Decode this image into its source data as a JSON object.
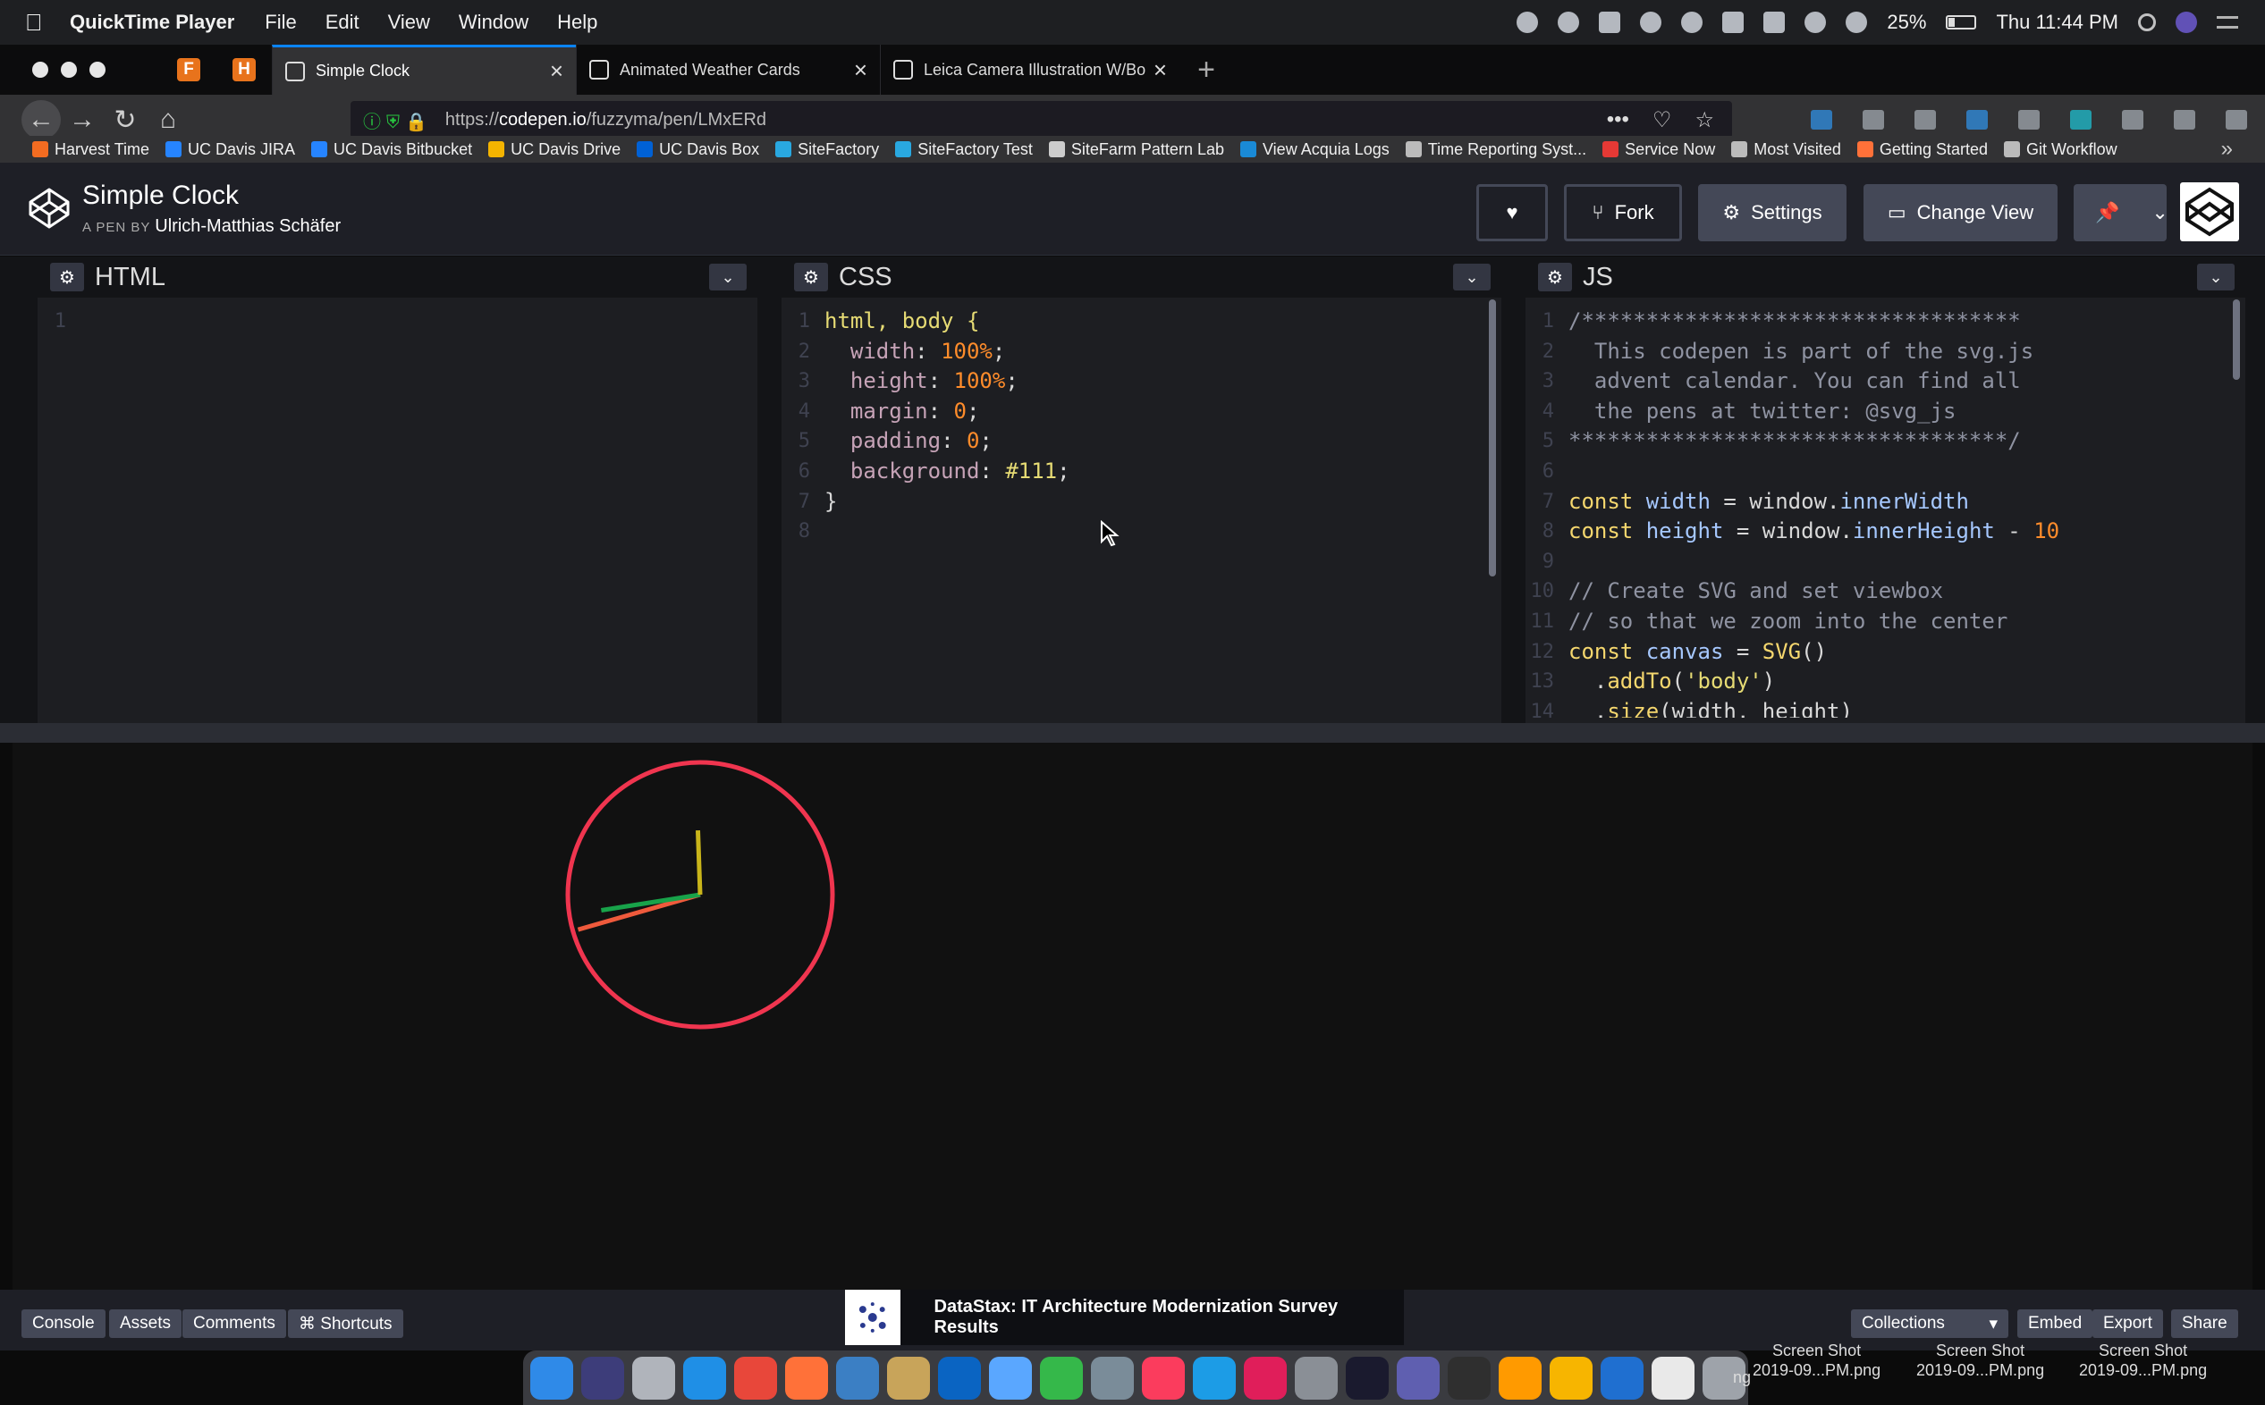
{
  "menubar": {
    "app_name": "QuickTime Player",
    "menus": [
      "File",
      "Edit",
      "View",
      "Window",
      "Help"
    ],
    "battery": "25%",
    "clock": "Thu 11:44 PM"
  },
  "tabs": [
    {
      "label": "Simple Clock",
      "active": true
    },
    {
      "label": "Animated Weather Cards",
      "active": false
    },
    {
      "label": "Leica Camera Illustration W/Bo",
      "active": false
    }
  ],
  "pinned_tabs": [
    "F",
    "H"
  ],
  "address": {
    "prefix": "https://",
    "host": "codepen.io",
    "path": "/fuzzyma/pen/LMxERd"
  },
  "bookmarks": [
    {
      "label": "Harvest Time",
      "color": "#f36c21"
    },
    {
      "label": "UC Davis JIRA",
      "color": "#2684ff"
    },
    {
      "label": "UC Davis Bitbucket",
      "color": "#2684ff"
    },
    {
      "label": "UC Davis Drive",
      "color": "#f4b400"
    },
    {
      "label": "UC Davis  Box",
      "color": "#0061d5"
    },
    {
      "label": "SiteFactory",
      "color": "#29a8e0"
    },
    {
      "label": "SiteFactory Test",
      "color": "#29a8e0"
    },
    {
      "label": "SiteFarm Pattern Lab",
      "color": "#cccccc"
    },
    {
      "label": "View Acquia Logs",
      "color": "#1a8ad6"
    },
    {
      "label": "Time Reporting Syst...",
      "color": "#bbbbbb"
    },
    {
      "label": "Service Now",
      "color": "#e53935"
    },
    {
      "label": "Most Visited",
      "color": "#bbbbbb"
    },
    {
      "label": "Getting Started",
      "color": "#ff7139"
    },
    {
      "label": "Git Workflow",
      "color": "#bbbbbb"
    }
  ],
  "pen": {
    "title": "Simple Clock",
    "by_prefix": "A PEN BY",
    "author": "Ulrich-Matthias Schäfer"
  },
  "header_buttons": {
    "fork": "Fork",
    "settings": "Settings",
    "change_view": "Change View"
  },
  "editors": {
    "html": {
      "label": "HTML",
      "lines": [
        "1"
      ]
    },
    "css": {
      "label": "CSS",
      "lines": [
        "html, body {",
        "  width: 100%;",
        "  height: 100%;",
        "  margin: 0;",
        "  padding: 0;",
        "  background: #111;",
        "}",
        ""
      ]
    },
    "js": {
      "label": "JS",
      "lines": [
        "/**********************************",
        "  This codepen is part of the svg.js",
        "  advent calendar. You can find all",
        "  the pens at twitter: @svg_js",
        "**********************************/",
        "",
        "const width = window.innerWidth",
        "const height = window.innerHeight - 10",
        "",
        "// Create SVG and set viewbox",
        "// so that we zoom into the center",
        "const canvas = SVG()",
        "  .addTo('body')",
        "  .size(width, height)"
      ]
    }
  },
  "clock": {
    "ring_color": "#f0354f",
    "hour_angle_deg": -2,
    "minute_angle_deg": 261,
    "second_angle_deg": 254,
    "hour_color": "#c9b51a",
    "minute_color": "#18a34a",
    "second_color": "#ef5a3c"
  },
  "footer": {
    "console": "Console",
    "assets": "Assets",
    "comments": "Comments",
    "shortcuts": "⌘ Shortcuts",
    "ad_text": "DataStax: IT Architecture Modernization Survey Results",
    "collections": "Collections",
    "embed": "Embed",
    "export": "Export",
    "share": "Share"
  },
  "desktop_files": [
    {
      "line1": "Screen Shot",
      "line2": "2019-09...PM.png"
    },
    {
      "line1": "Screen Shot",
      "line2": "2019-09...PM.png"
    },
    {
      "line1": "Screen Shot",
      "line2": "2019-09...PM.png"
    }
  ],
  "desktop_partial": "ng"
}
